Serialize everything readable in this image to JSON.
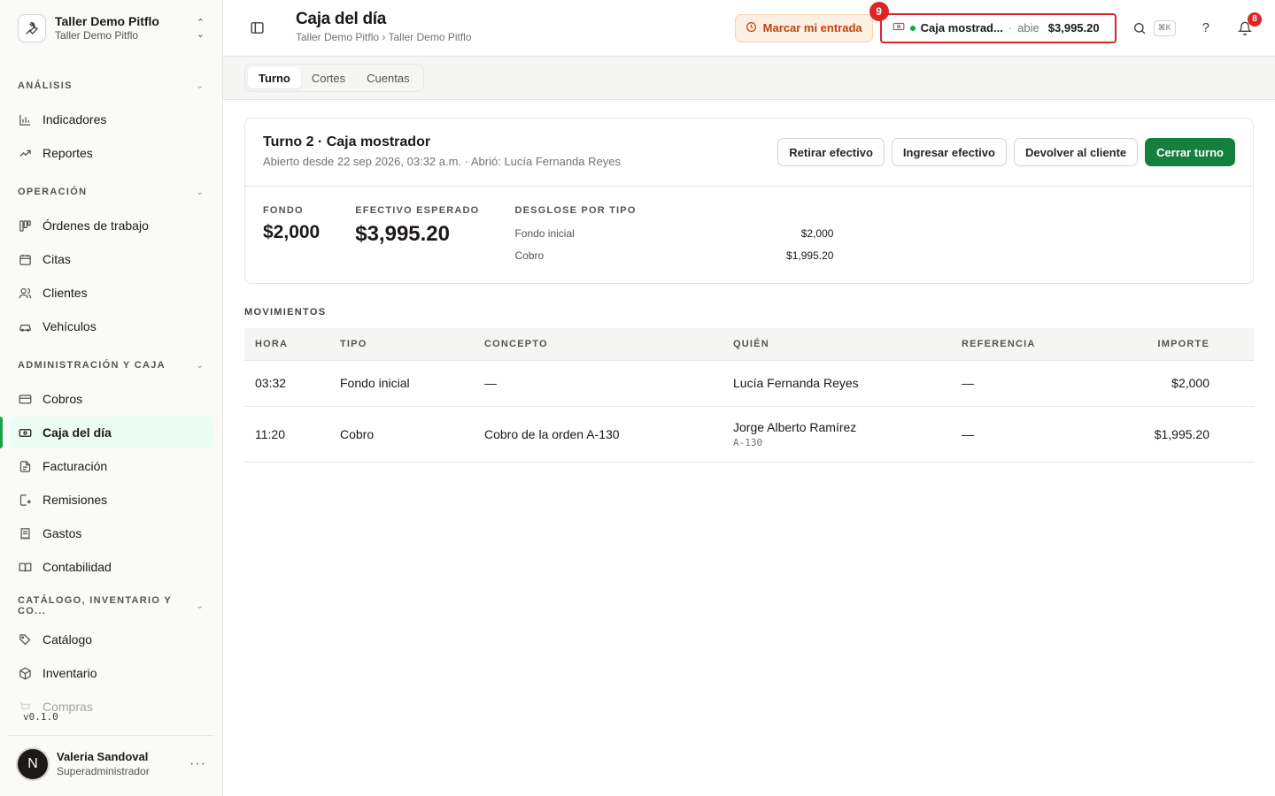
{
  "workspace": {
    "name": "Taller Demo Pitflo",
    "sub": "Taller Demo Pitflo"
  },
  "sidebar": {
    "sections": [
      {
        "title": "ANÁLISIS",
        "items": [
          {
            "label": "Indicadores",
            "icon": "bar-chart-icon"
          },
          {
            "label": "Reportes",
            "icon": "trend-icon"
          }
        ]
      },
      {
        "title": "OPERACIÓN",
        "items": [
          {
            "label": "Órdenes de trabajo",
            "icon": "kanban-icon"
          },
          {
            "label": "Citas",
            "icon": "calendar-icon"
          },
          {
            "label": "Clientes",
            "icon": "users-icon"
          },
          {
            "label": "Vehículos",
            "icon": "car-icon"
          }
        ]
      },
      {
        "title": "ADMINISTRACIÓN Y CAJA",
        "items": [
          {
            "label": "Cobros",
            "icon": "card-icon"
          },
          {
            "label": "Caja del día",
            "icon": "cash-icon"
          },
          {
            "label": "Facturación",
            "icon": "document-icon"
          },
          {
            "label": "Remisiones",
            "icon": "file-arrow-icon"
          },
          {
            "label": "Gastos",
            "icon": "receipt-icon"
          },
          {
            "label": "Contabilidad",
            "icon": "book-icon"
          }
        ]
      },
      {
        "title": "CATÁLOGO, INVENTARIO Y CO...",
        "items": [
          {
            "label": "Catálogo",
            "icon": "tag-icon"
          },
          {
            "label": "Inventario",
            "icon": "box-icon"
          },
          {
            "label": "Compras",
            "icon": "cart-icon"
          }
        ]
      }
    ],
    "version": "v0.1.0",
    "user": {
      "initial": "N",
      "name": "Valeria Sandoval",
      "role": "Superadministrador"
    }
  },
  "header": {
    "title": "Caja del día",
    "breadcrumb": "Taller Demo Pitflo › Taller Demo Pitflo",
    "checkin_label": "Marcar mi entrada",
    "register": {
      "name": "Caja mostrad...",
      "separator": "·",
      "state": "abie",
      "amount": "$3,995.20",
      "badge": "9"
    },
    "kbd": "⌘K",
    "help": "?",
    "notifications_badge": "8"
  },
  "tabs": [
    "Turno",
    "Cortes",
    "Cuentas"
  ],
  "shift": {
    "title": "Turno 2 · Caja mostrador",
    "subtitle": "Abierto desde 22 sep 2026, 03:32 a.m. · Abrió: Lucía Fernanda Reyes",
    "buttons": {
      "withdraw": "Retirar efectivo",
      "deposit": "Ingresar efectivo",
      "refund": "Devolver al cliente",
      "close": "Cerrar turno"
    },
    "fondo_label": "FONDO",
    "fondo_value": "$2,000",
    "expected_label": "EFECTIVO ESPERADO",
    "expected_value": "$3,995.20",
    "breakdown_label": "DESGLOSE POR TIPO",
    "breakdown": [
      {
        "label": "Fondo inicial",
        "amount": "$2,000"
      },
      {
        "label": "Cobro",
        "amount": "$1,995.20"
      }
    ]
  },
  "movements": {
    "title": "MOVIMIENTOS",
    "columns": [
      "HORA",
      "TIPO",
      "CONCEPTO",
      "QUIÉN",
      "REFERENCIA",
      "IMPORTE"
    ],
    "rows": [
      {
        "hora": "03:32",
        "tipo": "Fondo inicial",
        "concepto": "—",
        "quien": "Lucía Fernanda Reyes",
        "quien_ref": "",
        "referencia": "—",
        "importe": "$2,000"
      },
      {
        "hora": "11:20",
        "tipo": "Cobro",
        "concepto": "Cobro de la orden A-130",
        "quien": "Jorge Alberto Ramírez",
        "quien_ref": "A-130",
        "referencia": "—",
        "importe": "$1,995.20"
      }
    ]
  },
  "colors": {
    "accent": "#15803d",
    "active_bg": "#ecfdf5",
    "warning_bg": "#fdf0e3",
    "warning_text": "#c2410c",
    "alert": "#dc2626"
  }
}
